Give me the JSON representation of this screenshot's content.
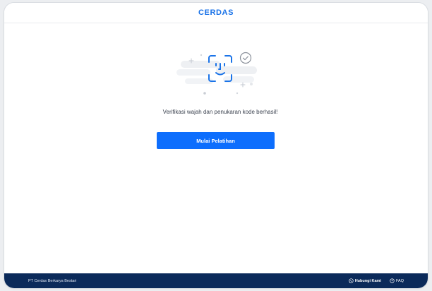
{
  "header": {
    "logo": "CERDAS"
  },
  "main": {
    "message": "Verifikasi wajah dan penukaran kode berhasil!",
    "cta_label": "Mulai Pelatihan"
  },
  "footer": {
    "company": "PT Cerdas Berkarya Bestari",
    "contact_label": "Hubungi Kami",
    "faq_label": "FAQ"
  },
  "colors": {
    "primary": "#0d6efd",
    "footer_bg": "#0b2a5a",
    "logo": "#1a73e8"
  },
  "icons": [
    "face-id-icon",
    "checkmark-icon",
    "whatsapp-icon",
    "help-icon"
  ]
}
